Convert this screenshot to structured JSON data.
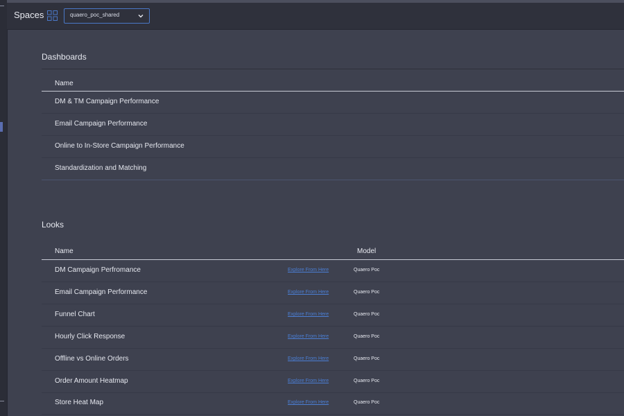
{
  "header": {
    "title": "Spaces",
    "space_select": {
      "value": "quaero_poc_shared"
    }
  },
  "dashboards": {
    "title": "Dashboards",
    "columns": {
      "name": "Name"
    },
    "rows": [
      "DM & TM Campaign Performance",
      "Email Campaign Performance",
      "Online to In-Store Campaign Performance",
      "Standardization and Matching"
    ]
  },
  "looks": {
    "title": "Looks",
    "columns": {
      "name": "Name",
      "model": "Model"
    },
    "link_label": "Explore From Here",
    "rows": [
      {
        "name": "DM Campaign Perfromance",
        "model": "Quaero Poc"
      },
      {
        "name": "Email Campaign Performance",
        "model": "Quaero Poc"
      },
      {
        "name": "Funnel Chart",
        "model": "Quaero Poc"
      },
      {
        "name": "Hourly Click Response",
        "model": "Quaero Poc"
      },
      {
        "name": "Offline vs Online Orders",
        "model": "Quaero Poc"
      },
      {
        "name": "Order Amount Heatmap",
        "model": "Quaero Poc"
      },
      {
        "name": "Store Heat Map",
        "model": "Quaero Poc"
      }
    ]
  },
  "colors": {
    "link": "#4b7fd6",
    "focus": "#4a78c8",
    "background": "#3e414f"
  }
}
